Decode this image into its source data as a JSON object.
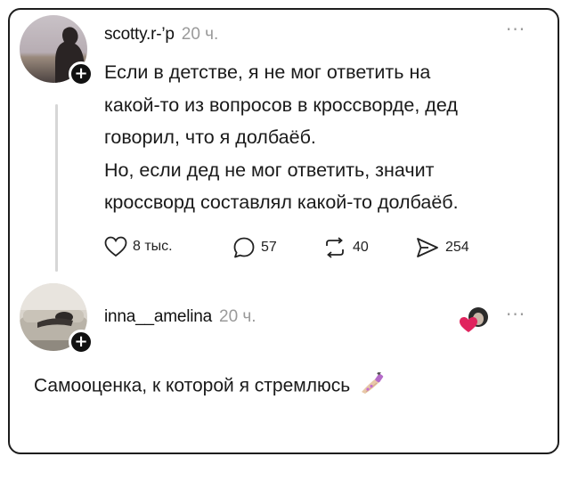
{
  "post": {
    "username": "scotty.r‐’p",
    "time": "20 ч.",
    "more_label": "···",
    "lines": [
      "Если в детстве, я не мог ответить на",
      "какой-то из вопросов в кроссворде, дед",
      "говорил, что я долбаёб.",
      "Но, если дед не мог ответить, значит",
      "кроссворд составлял какой-то долбаёб."
    ],
    "actions": {
      "likes": "8 тыс.",
      "comments": "57",
      "reposts": "40",
      "shares": "254"
    }
  },
  "reply": {
    "username": "inna__amelina",
    "time": "20 ч.",
    "more_label": "···",
    "text": "Самооценка, к которой я стремлюсь"
  },
  "icons": {
    "follow": "plus-icon",
    "like": "heart-icon",
    "comment": "comment-icon",
    "repost": "repost-icon",
    "share": "send-icon",
    "reply_reaction": "heart-avatar-icon",
    "nail_polish": "nail-polish-emoji"
  },
  "colors": {
    "border": "#1d1d1d",
    "muted": "#9a9a9a",
    "thread_line": "#d6d6d6",
    "heart_red": "#e0245e"
  }
}
